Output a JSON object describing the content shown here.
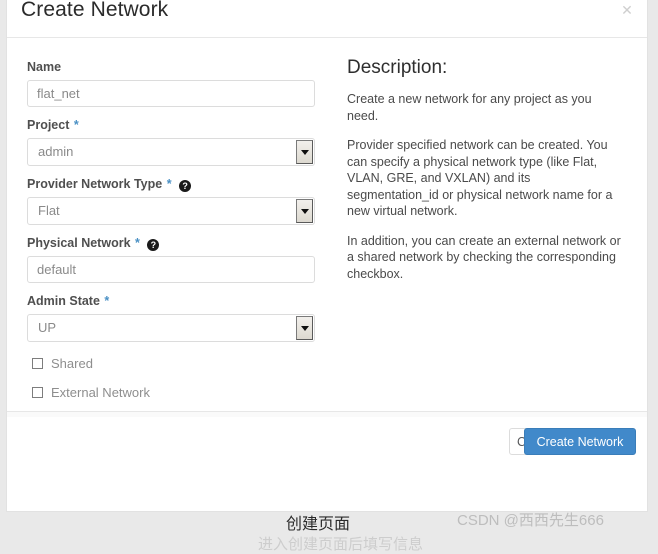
{
  "modal": {
    "title": "Create Network",
    "close_icon": "close-icon",
    "close_glyph": "✕"
  },
  "form": {
    "fields": [
      {
        "label": "Name",
        "required": false,
        "help": false,
        "type": "text",
        "value": "flat_net",
        "placeholder": "flat_net"
      },
      {
        "label": "Project",
        "required": true,
        "help": false,
        "type": "select",
        "value": "admin"
      },
      {
        "label": "Provider Network Type",
        "required": true,
        "help": true,
        "type": "select",
        "value": "Flat"
      },
      {
        "label": "Physical Network",
        "required": true,
        "help": true,
        "type": "text",
        "value": "default",
        "placeholder": "default"
      },
      {
        "label": "Admin State",
        "required": true,
        "help": false,
        "type": "select",
        "value": "UP"
      }
    ],
    "required_marker": "*",
    "help_glyph": "?",
    "checkboxes": [
      {
        "label": "Shared",
        "checked": false
      },
      {
        "label": "External Network",
        "checked": false
      }
    ]
  },
  "description": {
    "title": "Description:",
    "paragraphs": [
      "Create a new network for any project as you need.",
      "Provider specified network can be created. You can specify a physical network type (like Flat, VLAN, GRE, and VXLAN) and its segmentation_id or physical network name for a new virtual network.",
      "In addition, you can create an external network or a shared network by checking the corresponding checkbox."
    ]
  },
  "footer": {
    "cancel_label": "Cancel",
    "submit_label": "Create Network"
  },
  "page": {
    "caption": "创建页面",
    "caption_faded": "进入创建页面后填写信息",
    "watermark": "CSDN @西西先生666"
  },
  "colors": {
    "accent": "#4189ca",
    "required_star": "#4a90c4",
    "label": "#4f4f4f",
    "placeholder": "#9b9b9b"
  }
}
